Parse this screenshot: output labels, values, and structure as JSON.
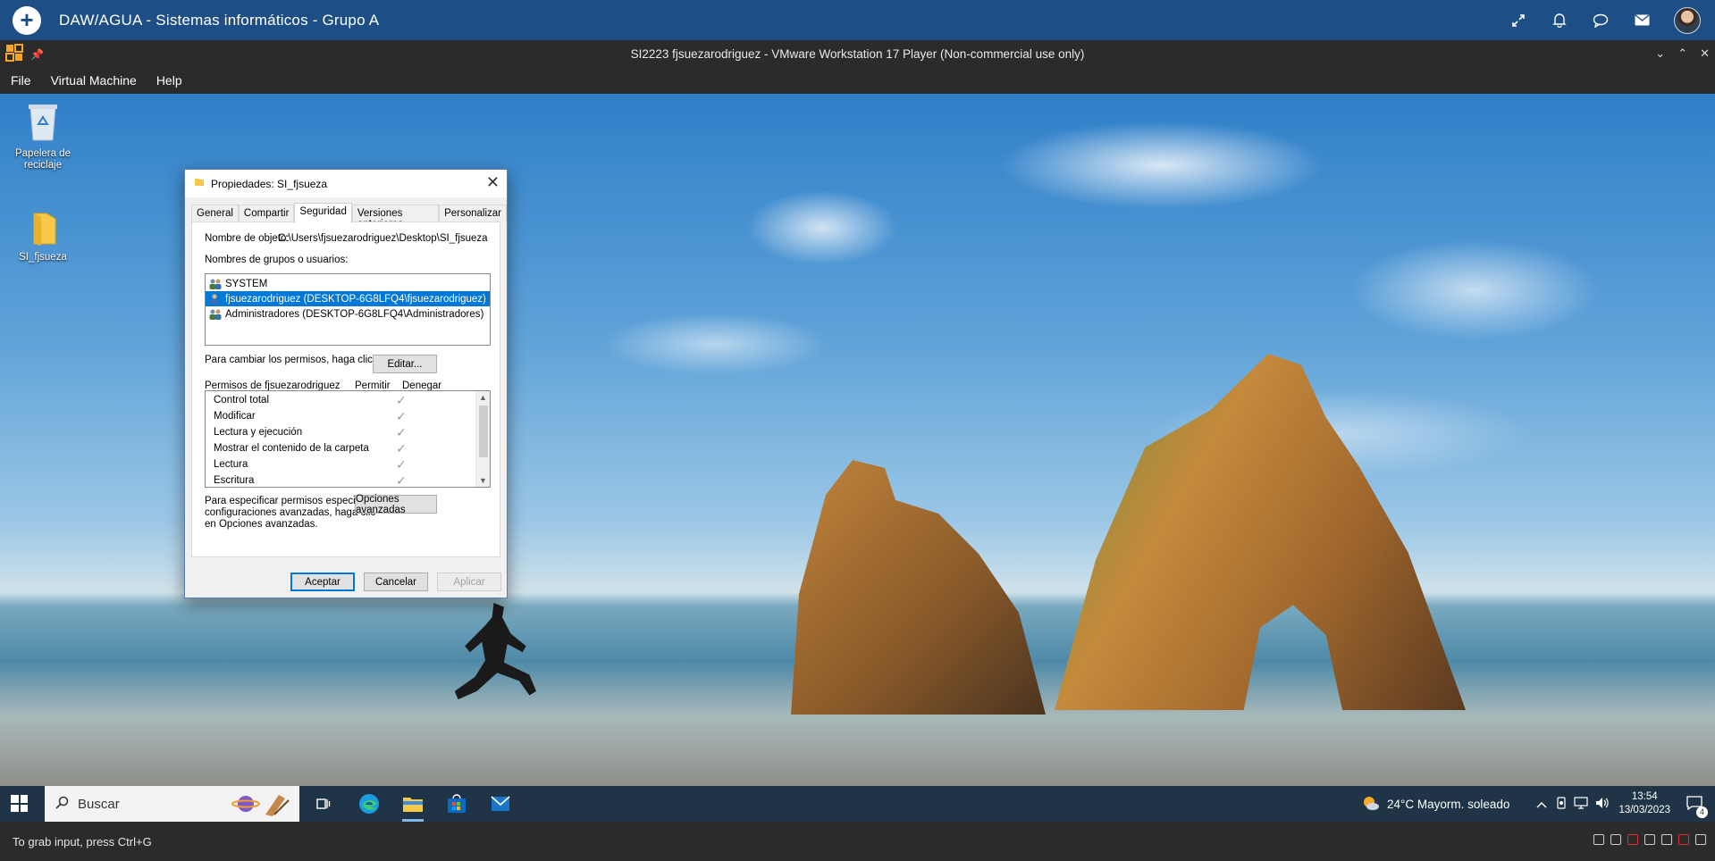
{
  "appbar": {
    "title": "DAW/AGUA - Sistemas informáticos - Grupo A",
    "icons": [
      "add-icon",
      "expand-icon",
      "bell-icon",
      "chat-icon",
      "mail-icon",
      "avatar"
    ]
  },
  "vmware": {
    "title": "SI2223 fjsuezarodriguez - VMware Workstation 17 Player (Non-commercial use only)",
    "menu": [
      "File",
      "Virtual Machine",
      "Help"
    ],
    "status_text": "To grab input, press Ctrl+G"
  },
  "desktop": {
    "icons": [
      {
        "label": "Papelera de reciclaje",
        "icon": "recycle-bin-icon"
      },
      {
        "label": "SI_fjsueza",
        "icon": "folder-icon"
      }
    ]
  },
  "dialog": {
    "title": "Propiedades: SI_fjsueza",
    "tabs": [
      "General",
      "Compartir",
      "Seguridad",
      "Versiones anteriores",
      "Personalizar"
    ],
    "active_tab": "Seguridad",
    "object_label": "Nombre de objeto:",
    "object_value": "C:\\Users\\fjsuezarodriguez\\Desktop\\SI_fjsueza",
    "groups_label": "Nombres de grupos o usuarios:",
    "groups": [
      "SYSTEM",
      "fjsuezarodriguez (DESKTOP-6G8LFQ4\\fjsuezarodriguez)",
      "Administradores (DESKTOP-6G8LFQ4\\Administradores)"
    ],
    "selected_group_index": 1,
    "edit_hint": "Para cambiar los permisos, haga clic en Editar.",
    "edit_button": "Editar...",
    "perms_label": "Permisos de fjsuezarodriguez",
    "perms_allow": "Permitir",
    "perms_deny": "Denegar",
    "permissions": [
      {
        "name": "Control total",
        "allow": "✓"
      },
      {
        "name": "Modificar",
        "allow": "✓"
      },
      {
        "name": "Lectura y ejecución",
        "allow": "✓"
      },
      {
        "name": "Mostrar el contenido de la carpeta",
        "allow": "✓"
      },
      {
        "name": "Lectura",
        "allow": "✓"
      },
      {
        "name": "Escritura",
        "allow": "✓"
      }
    ],
    "advanced_hint_1": "Para especificar permisos especiales o",
    "advanced_hint_2": "configuraciones avanzadas, haga clic",
    "advanced_hint_3": "en Opciones avanzadas.",
    "advanced_button": "Opciones avanzadas",
    "ok_button": "Aceptar",
    "cancel_button": "Cancelar",
    "apply_button": "Aplicar",
    "close_glyph": "✕"
  },
  "taskbar": {
    "search_placeholder": "Buscar",
    "weather": "24°C  Mayorm. soleado",
    "time": "13:54",
    "date": "13/03/2023",
    "notifications": "4"
  }
}
